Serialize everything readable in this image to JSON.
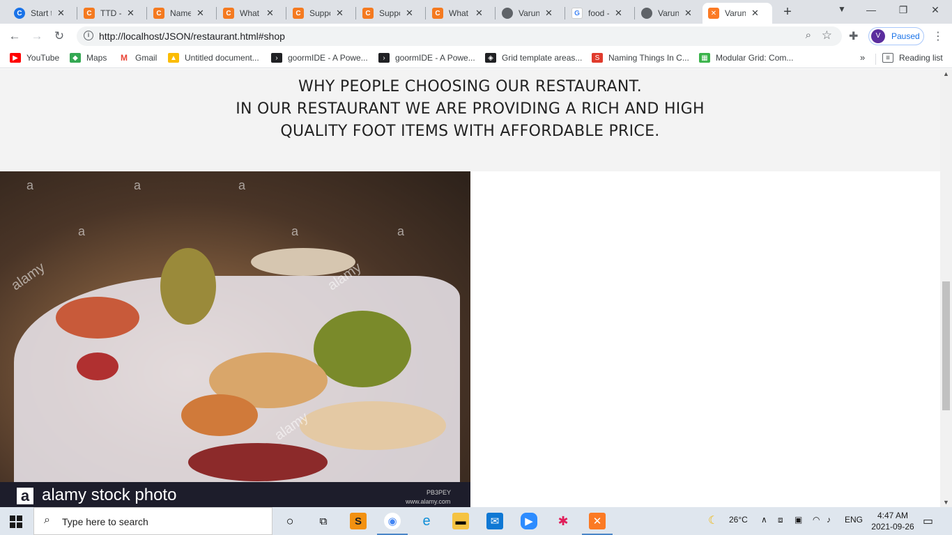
{
  "browser": {
    "tabs": [
      {
        "title": "Start th",
        "icon": "chrome-icon"
      },
      {
        "title": "TTD - ",
        "icon": "c-site-icon"
      },
      {
        "title": "Name",
        "icon": "c-site-icon"
      },
      {
        "title": "What L",
        "icon": "c-site-icon"
      },
      {
        "title": "Suppo",
        "icon": "c-site-icon"
      },
      {
        "title": "Suppo",
        "icon": "c-site-icon"
      },
      {
        "title": "What L",
        "icon": "c-site-icon"
      },
      {
        "title": "Varun'",
        "icon": "globe-icon"
      },
      {
        "title": "food -",
        "icon": "google-icon"
      },
      {
        "title": "Varun'",
        "icon": "globe-icon"
      },
      {
        "title": "Varun'",
        "icon": "xampp-icon"
      }
    ],
    "tab_close": "✕",
    "new_tab": "+",
    "url": "http://localhost/JSON/restaurant.html#shop",
    "profile": {
      "initial": "V",
      "status": "Paused"
    },
    "bookmarks": [
      {
        "label": "YouTube",
        "color": "#ff0000"
      },
      {
        "label": "Maps",
        "color": "#34a853"
      },
      {
        "label": "Gmail",
        "color": "#ea4335"
      },
      {
        "label": "Untitled document...",
        "color": "#fbbc04"
      },
      {
        "label": "goormIDE - A Powe...",
        "color": "#202124"
      },
      {
        "label": "goormIDE - A Powe...",
        "color": "#202124"
      },
      {
        "label": "Grid template areas...",
        "color": "#202124"
      },
      {
        "label": "Naming Things In C...",
        "color": "#e03b2d"
      },
      {
        "label": "Modular Grid: Com...",
        "color": "#3ab34a"
      }
    ],
    "bookmarks_more": "»",
    "reading_list": "Reading list"
  },
  "page": {
    "hero_lines": [
      "WHY PEOPLE CHOOSING OUR RESTAURANT.",
      "IN OUR RESTAURANT WE ARE PROVIDING A RICH AND HIGH",
      "QUALITY FOOT ITEMS WITH AFFORDABLE PRICE."
    ],
    "photo": {
      "watermark": "a",
      "watermark_word": "alamy",
      "brand_letter": "a",
      "brand": "alamy stock photo",
      "image_code": "PB3PEY",
      "site": "www.alamy.com"
    }
  },
  "taskbar": {
    "search_placeholder": "Type here to search",
    "weather": "26°C",
    "language": "ENG",
    "time": "4:47 AM",
    "date": "2021-09-26"
  }
}
